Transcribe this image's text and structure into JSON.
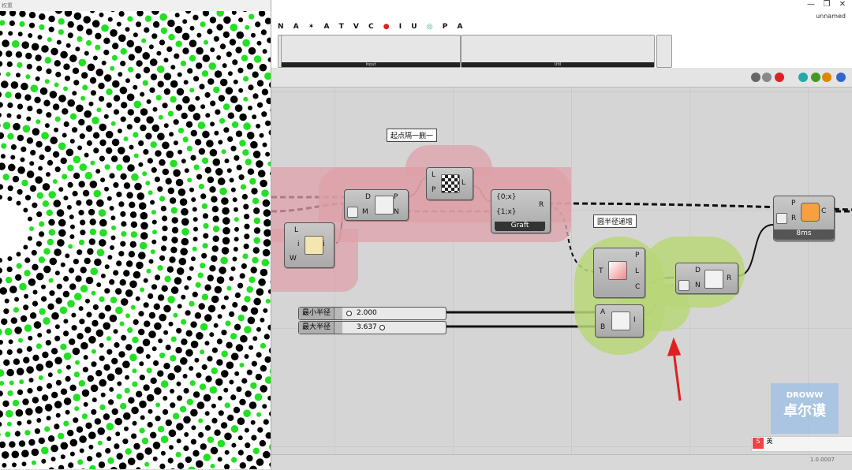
{
  "viewport": {
    "title": "权重"
  },
  "window": {
    "doc_name": "unnamed",
    "minimize": "—",
    "restore": "❐",
    "close": "✕"
  },
  "tabs": [
    "N",
    "A",
    "✶",
    "A",
    "T",
    "V",
    "C",
    "●",
    "I",
    "U",
    "◎",
    "P",
    "A"
  ],
  "ribbon": {
    "input_label": "Input",
    "util_label": "Util"
  },
  "groups": {
    "pink_title": "起点隔一删一",
    "green_title": "圆半径递增"
  },
  "components": {
    "list_item": {
      "ports_in": [
        "L",
        "i",
        "W"
      ],
      "ports_out": [
        "i"
      ]
    },
    "dispatch": {
      "ports_in": [
        "D",
        "M"
      ],
      "ports_out": [
        "P",
        "N"
      ]
    },
    "cull": {
      "ports_in": [
        "L",
        "P"
      ],
      "ports_out": [
        "L"
      ]
    },
    "graft": {
      "ports_in": [
        "{0;x}",
        "{1;x}"
      ],
      "ports_out": [
        "R"
      ],
      "footer": "Graft"
    },
    "series": {
      "ports_in": [
        "T"
      ],
      "ports_out": [
        "P",
        "L",
        "C"
      ]
    },
    "remap": {
      "ports_in": [
        "D",
        "N"
      ],
      "ports_out": [
        "R"
      ]
    },
    "bounds": {
      "ports_in": [
        "A",
        "B"
      ],
      "ports_out": [
        "I"
      ]
    },
    "circle": {
      "ports_in": [
        "P",
        "R"
      ],
      "ports_out": [
        "C"
      ],
      "footer": "8ms"
    }
  },
  "sliders": [
    {
      "label": "最小半径",
      "value": "2.000"
    },
    {
      "label": "最大半径",
      "value": "3.637"
    }
  ],
  "status": {
    "version": "1.0.0007"
  },
  "watermark": {
    "line1": "DROWW",
    "line2": "卓尔谟"
  },
  "ime": {
    "brand": "S",
    "lang": "英"
  },
  "colors": {
    "pink_group": "#dea0aa",
    "green_group": "#b9d778",
    "accent_green": "#22e022",
    "arrow_red": "#e02020"
  }
}
